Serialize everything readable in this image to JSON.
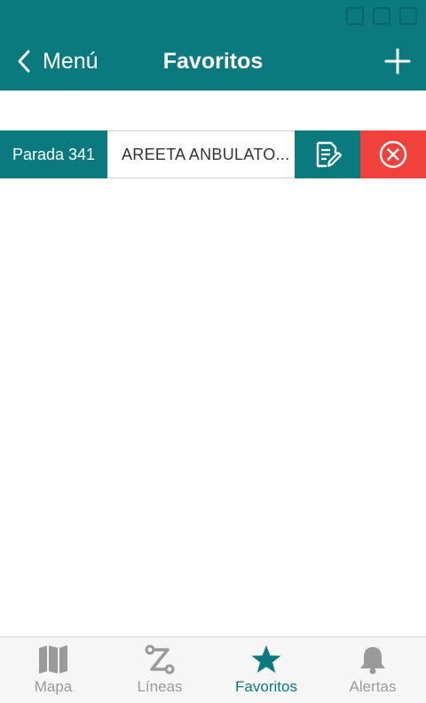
{
  "header": {
    "back_label": "Menú",
    "title": "Favoritos"
  },
  "favorites": [
    {
      "stop_label": "Parada 341",
      "stop_name": "AREETA ANBULATO..."
    }
  ],
  "tabs": [
    {
      "label": "Mapa",
      "icon": "map-icon",
      "active": false
    },
    {
      "label": "Líneas",
      "icon": "route-icon",
      "active": false
    },
    {
      "label": "Favoritos",
      "icon": "star-icon",
      "active": true
    },
    {
      "label": "Alertas",
      "icon": "bell-icon",
      "active": false
    }
  ],
  "colors": {
    "primary": "#0a7a7f",
    "danger": "#f2413c",
    "inactive": "#9a9a9a"
  }
}
